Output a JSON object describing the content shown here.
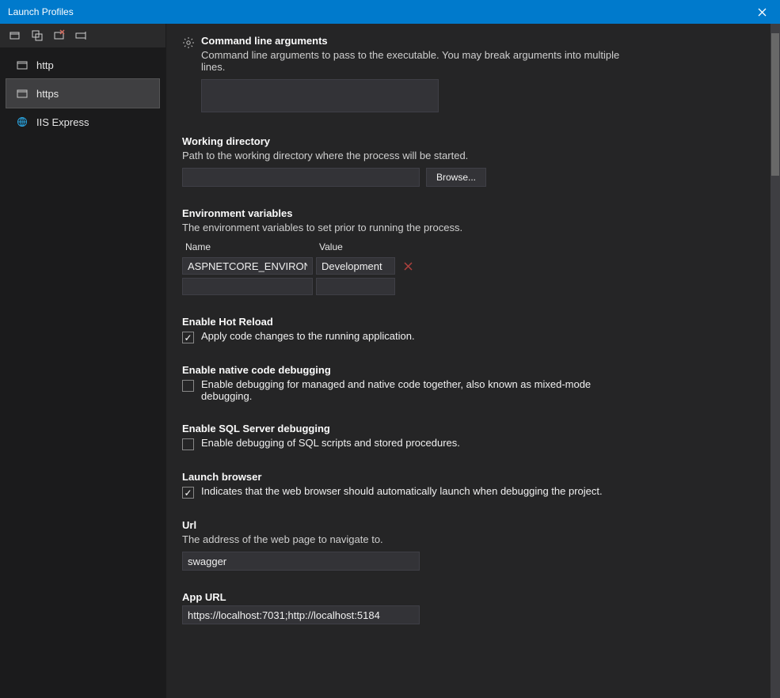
{
  "window": {
    "title": "Launch Profiles"
  },
  "sidebar": {
    "items": [
      {
        "label": "http",
        "icon": "project"
      },
      {
        "label": "https",
        "icon": "project",
        "selected": true
      },
      {
        "label": "IIS Express",
        "icon": "globe"
      }
    ]
  },
  "sections": {
    "cli": {
      "title": "Command line arguments",
      "desc": "Command line arguments to pass to the executable. You may break arguments into multiple lines.",
      "value": ""
    },
    "wd": {
      "title": "Working directory",
      "desc": "Path to the working directory where the process will be started.",
      "value": "",
      "browse": "Browse..."
    },
    "env": {
      "title": "Environment variables",
      "desc": "The environment variables to set prior to running the process.",
      "col_name": "Name",
      "col_value": "Value",
      "rows": [
        {
          "name": "ASPNETCORE_ENVIRONMENT",
          "value": "Development"
        },
        {
          "name": "",
          "value": ""
        }
      ]
    },
    "hot": {
      "title": "Enable Hot Reload",
      "label": "Apply code changes to the running application.",
      "checked": true
    },
    "native": {
      "title": "Enable native code debugging",
      "label": "Enable debugging for managed and native code together, also known as mixed-mode debugging.",
      "checked": false
    },
    "sql": {
      "title": "Enable SQL Server debugging",
      "label": "Enable debugging of SQL scripts and stored procedures.",
      "checked": false
    },
    "launch": {
      "title": "Launch browser",
      "label": "Indicates that the web browser should automatically launch when debugging the project.",
      "checked": true
    },
    "url": {
      "title": "Url",
      "desc": "The address of the web page to navigate to.",
      "value": "swagger"
    },
    "appurl": {
      "title": "App URL",
      "value": "https://localhost:7031;http://localhost:5184"
    }
  }
}
